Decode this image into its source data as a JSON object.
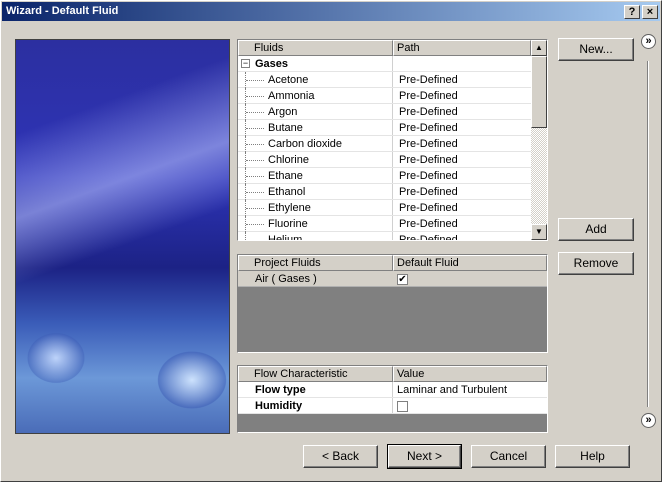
{
  "window": {
    "title": "Wizard - Default Fluid",
    "help_btn": "?",
    "close_btn": "×"
  },
  "fluids_table": {
    "headers": [
      "Fluids",
      "Path"
    ],
    "group": "Gases",
    "group_toggle": "−",
    "rows": [
      {
        "name": "Acetone",
        "path": "Pre-Defined"
      },
      {
        "name": "Ammonia",
        "path": "Pre-Defined"
      },
      {
        "name": "Argon",
        "path": "Pre-Defined"
      },
      {
        "name": "Butane",
        "path": "Pre-Defined"
      },
      {
        "name": "Carbon dioxide",
        "path": "Pre-Defined"
      },
      {
        "name": "Chlorine",
        "path": "Pre-Defined"
      },
      {
        "name": "Ethane",
        "path": "Pre-Defined"
      },
      {
        "name": "Ethanol",
        "path": "Pre-Defined"
      },
      {
        "name": "Ethylene",
        "path": "Pre-Defined"
      },
      {
        "name": "Fluorine",
        "path": "Pre-Defined"
      },
      {
        "name": "Helium",
        "path": "Pre-Defined"
      }
    ]
  },
  "project_table": {
    "headers": [
      "Project Fluids",
      "Default Fluid"
    ],
    "rows": [
      {
        "name": "Air ( Gases )",
        "default_checked": true,
        "check_mark": "✔"
      }
    ]
  },
  "flow_table": {
    "headers": [
      "Flow Characteristic",
      "Value"
    ],
    "rows": [
      {
        "name": "Flow type",
        "value": "Laminar and Turbulent"
      },
      {
        "name": "Humidity",
        "value": ""
      }
    ]
  },
  "side_buttons": {
    "new": "New...",
    "add": "Add",
    "remove": "Remove"
  },
  "nav_buttons": {
    "back": "< Back",
    "next": "Next >",
    "cancel": "Cancel",
    "help": "Help"
  },
  "icons": {
    "chevron": "»",
    "scroll_up": "▲",
    "scroll_down": "▼"
  }
}
